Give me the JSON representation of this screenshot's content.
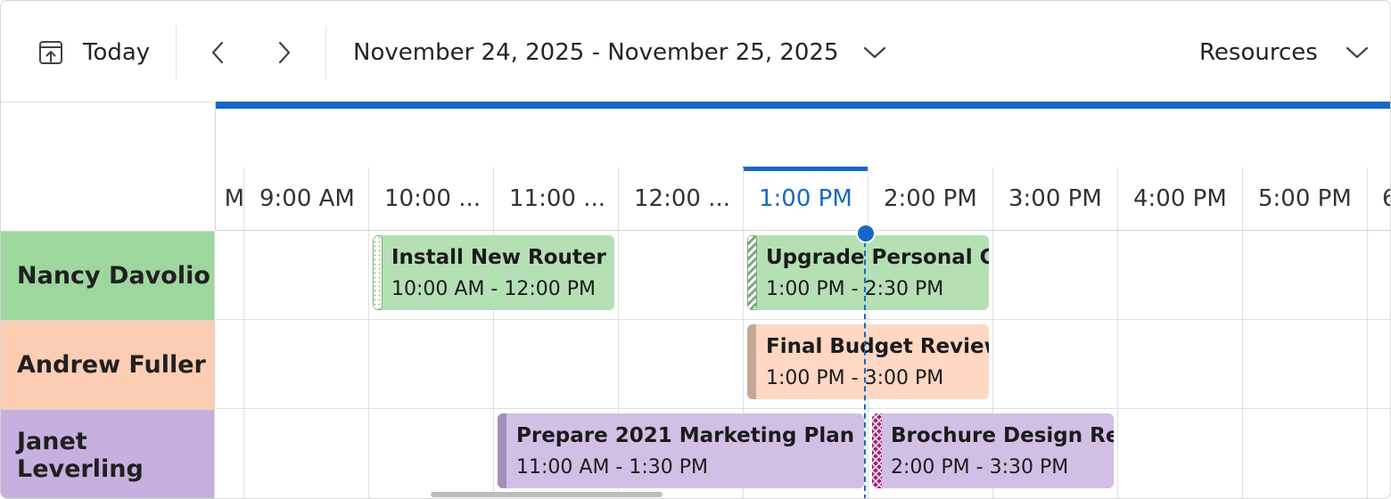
{
  "toolbar": {
    "today_label": "Today",
    "today_icon": "today-icon",
    "prev_icon": "chevron-left-icon",
    "next_icon": "chevron-right-icon",
    "date_range": "November 24, 2025 - November 25, 2025",
    "resources_label": "Resources"
  },
  "colors": {
    "accent": "#1568c6",
    "nancy": "#9ed79e",
    "andrew": "#fdcdb3",
    "janet": "#c7b0df"
  },
  "timeline": {
    "partial_left": "M",
    "slots": [
      "9:00 AM",
      "10:00 ...",
      "11:00 ...",
      "12:00 ...",
      "1:00 PM",
      "2:00 PM",
      "3:00 PM",
      "4:00 PM",
      "5:00 PM",
      "6"
    ],
    "current_slot": "1:00 PM"
  },
  "resources": [
    {
      "name": "Nancy Davolio"
    },
    {
      "name": "Andrew Fuller"
    },
    {
      "name": "Janet Leverling"
    }
  ],
  "events": [
    {
      "title": "Install New Router in Dev Room",
      "time": "10:00 AM - 12:00 PM"
    },
    {
      "title": "Upgrade Personal Computers",
      "time": "1:00 PM - 2:30 PM"
    },
    {
      "title": "Final Budget Review",
      "time": "1:00 PM - 3:00 PM"
    },
    {
      "title": "Prepare 2021 Marketing Plan",
      "time": "11:00 AM - 1:30 PM"
    },
    {
      "title": "Brochure Design Review",
      "time": "2:00 PM - 3:30 PM"
    }
  ]
}
